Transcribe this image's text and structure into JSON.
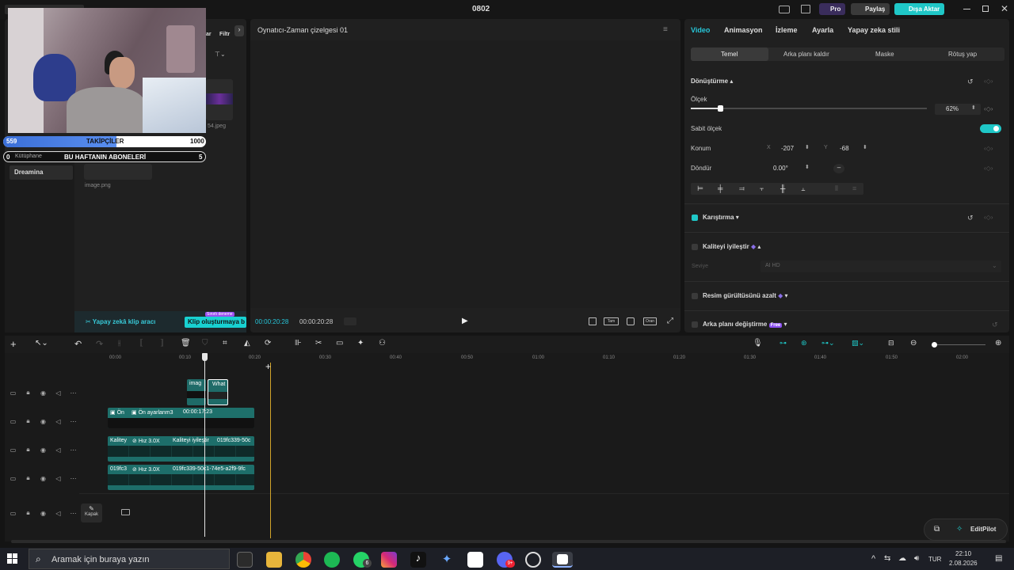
{
  "titlebar": {
    "title": "0802",
    "pro": "Pro",
    "share": "Paylaş",
    "export": "Dışa Aktar"
  },
  "overlay": {
    "followers_left": "559",
    "followers_label": "TAKİPÇİLER",
    "followers_right": "1000",
    "subs_left": "0",
    "subs_label": "BU HAFTANIN ABONELERİ",
    "subs_right": "5"
  },
  "media": {
    "tab_partial_1": "lar",
    "tab_partial_2": "Filtr",
    "library_item": "Kütüphane",
    "dreamina_item": "Dreamina",
    "file1": "54.jpeg",
    "file2": "image.png",
    "ai_clip_tool": "Yapay zekâ klip aracı",
    "create_clip": "Klip oluşturmaya b",
    "create_badge": "Sınırlı deneme"
  },
  "player": {
    "title": "Oynatıcı-Zaman çizelgesi 01",
    "current_time": "00:00:20:28",
    "total_time": "00:00:20:28",
    "full_label": "Tam",
    "ratio_label": "Oran"
  },
  "inspector": {
    "tabs": [
      "Video",
      "Animasyon",
      "İzleme",
      "Ayarla",
      "Yapay zeka stili"
    ],
    "subtabs": [
      "Temel",
      "Arka planı kaldır",
      "Maske",
      "Rötuş yap"
    ],
    "transform": "Dönüştürme",
    "scale": "Ölçek",
    "scale_value": "62%",
    "scale_fraction": 0.62,
    "uniform_scale": "Sabit ölçek",
    "position": "Konum",
    "pos_x_label": "X",
    "pos_x": "-207",
    "pos_y_label": "Y",
    "pos_y": "-68",
    "rotate": "Döndür",
    "rotate_value": "0.00°",
    "blend": "Karıştırma",
    "quality": "Kaliteyi iyileştir",
    "level": "Seviye",
    "level_value": "AI HD",
    "denoise": "Resim gürültüsünü azalt",
    "bg_change": "Arka planı değiştirme",
    "free_badge": "Free"
  },
  "timeline": {
    "ruler": [
      "00:00",
      "00:10",
      "00:20",
      "00:30",
      "00:40",
      "00:50",
      "01:00",
      "01:10",
      "01:20",
      "01:30",
      "01:40",
      "01:50",
      "02:00"
    ],
    "cover_label": "Kapak",
    "clip_image": "imag",
    "clip_what": "What",
    "fx_on": "Ön",
    "fx_preset": "Ön ayarlanm3",
    "fx_time": "00:00:17:23",
    "q1": "Kalitey",
    "speed1": "Hız 3.0X",
    "q2": "Kaliteyi iyileştir",
    "id1": "019fc339-50c",
    "id_short": "019fc3",
    "speed2": "Hız 3.0X",
    "id2": "019fc339-50c1-74e5-a2f9-9fc"
  },
  "editpilot": {
    "label": "EditPilot"
  },
  "taskbar": {
    "search": "Aramak için buraya yazın",
    "lang": "TUR",
    "time": "22:10",
    "date": "2.08.2026",
    "whatsapp_badge": "6",
    "discord_badge": "9+"
  }
}
